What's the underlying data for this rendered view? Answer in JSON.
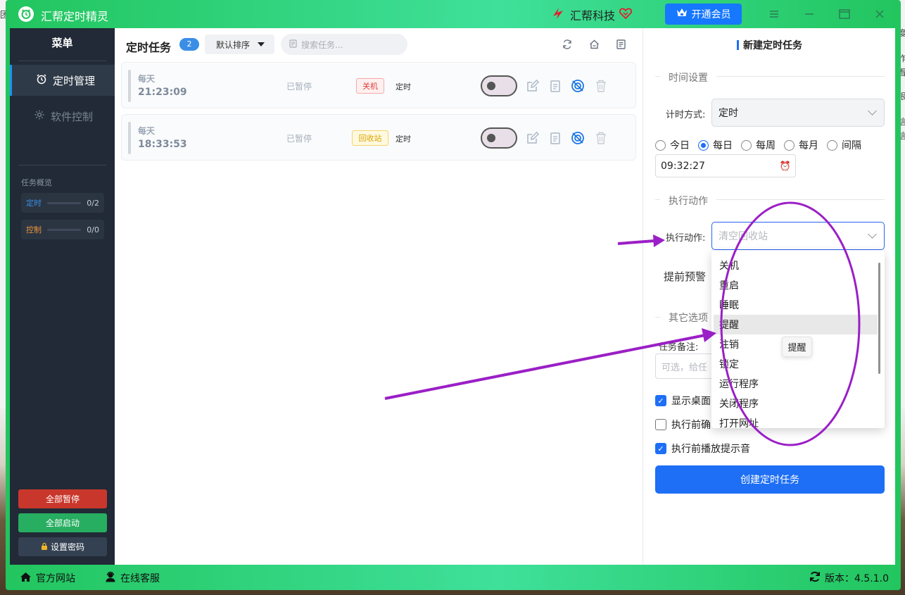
{
  "app": {
    "title": "汇帮定时精灵",
    "brand": "汇帮科技",
    "vip_button": "开通会员"
  },
  "desktop": {
    "left_char": "团",
    "right_chars": [
      "度",
      "作",
      "看",
      "根",
      "信",
      "信"
    ]
  },
  "sidebar": {
    "menu_title": "菜单",
    "nav": [
      {
        "label": "定时管理",
        "active": true
      },
      {
        "label": "软件控制",
        "active": false
      }
    ],
    "overview_title": "任务概览",
    "overview": [
      {
        "label": "定时",
        "value": "0/2",
        "color": "#3a8ee6"
      },
      {
        "label": "控制",
        "value": "0/0",
        "color": "#e8923a"
      }
    ],
    "buttons": {
      "pause_all": "全部暂停",
      "start_all": "全部启动",
      "set_password": "设置密码"
    }
  },
  "tasks": {
    "title": "定时任务",
    "count": "2",
    "sort_label": "默认排序",
    "search_placeholder": "搜索任务...",
    "items": [
      {
        "freq": "每天",
        "time": "21:23:09",
        "status": "已暂停",
        "action": "关机",
        "type": "定时"
      },
      {
        "freq": "每天",
        "time": "18:33:53",
        "status": "已暂停",
        "action": "回收站",
        "type": "定时"
      }
    ]
  },
  "new_task": {
    "title": "新建定时任务",
    "time_section": "时间设置",
    "timing_mode_label": "计时方式:",
    "timing_mode_value": "定时",
    "frequency_options": [
      "今日",
      "每日",
      "每周",
      "每月",
      "间隔"
    ],
    "frequency_selected": "每日",
    "time_value": "09:32:27",
    "action_section": "执行动作",
    "action_label": "执行动作:",
    "action_value": "清空回收站",
    "warning_label": "提前预警",
    "other_section": "其它选项",
    "note_label": "任务备注:",
    "note_placeholder": "可选，给任",
    "checkboxes": [
      {
        "label": "显示桌面",
        "checked": true
      },
      {
        "label": "执行前确",
        "checked": false
      },
      {
        "label": "执行前播放提示音",
        "checked": true
      }
    ],
    "create_button": "创建定时任务"
  },
  "dropdown": {
    "options": [
      "关机",
      "重启",
      "睡眠",
      "提醒",
      "注销",
      "锁定",
      "运行程序",
      "关闭程序",
      "打开网址"
    ],
    "highlighted": "提醒",
    "tooltip": "提醒"
  },
  "statusbar": {
    "website": "官方网站",
    "support": "在线客服",
    "version": "版本：4.5.1.0"
  },
  "annotation": {
    "color": "#9b1fc6"
  }
}
